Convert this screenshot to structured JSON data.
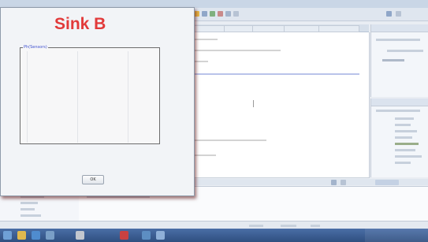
{
  "dialog": {
    "title": "Sink B",
    "group_label": "Ph(Sensors)",
    "ok_label": "OK"
  },
  "colors": {
    "title_red": "#e23a3a",
    "group_label_blue": "#3a4fcf",
    "taskbar_blue": "#3b5d93"
  },
  "icons": [
    "start-orb-icon",
    "explorer-icon",
    "browser-icon",
    "media-icon",
    "app-icon",
    "java-icon",
    "terminal-icon",
    "folder-icon"
  ]
}
